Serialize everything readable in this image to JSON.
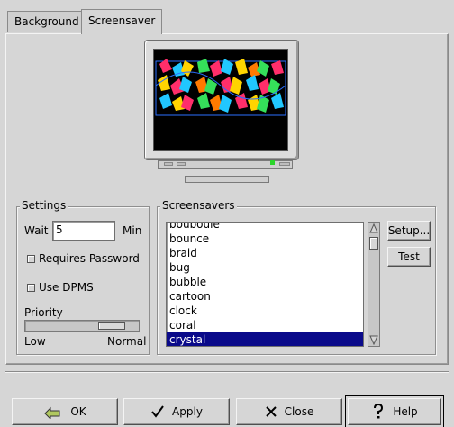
{
  "tabs": [
    {
      "label": "Background",
      "active": false
    },
    {
      "label": "Screensaver",
      "active": true
    }
  ],
  "settings": {
    "title": "Settings",
    "wait_label": "Wait",
    "wait_value": "5",
    "wait_unit": "Min",
    "requires_password_label": "Requires Password",
    "requires_password_checked": false,
    "use_dpms_label": "Use DPMS",
    "use_dpms_checked": false,
    "priority_label": "Priority",
    "priority_low": "Low",
    "priority_high": "Normal",
    "priority_level": 0.85
  },
  "screensavers": {
    "title": "Screensavers",
    "items": [
      "bouboule",
      "bounce",
      "braid",
      "bug",
      "bubble",
      "cartoon",
      "clock",
      "coral",
      "crystal"
    ],
    "selected": "crystal",
    "setup_label": "Setup...",
    "test_label": "Test"
  },
  "buttons": {
    "ok": "OK",
    "apply": "Apply",
    "close": "Close",
    "help": "Help"
  },
  "icons": {
    "ok": "ok-icon",
    "apply": "checkmark-icon",
    "close": "close-icon",
    "help": "help-icon"
  },
  "colors": {
    "selection": "#0a0a8a",
    "window_bg": "#d6d6d6"
  }
}
